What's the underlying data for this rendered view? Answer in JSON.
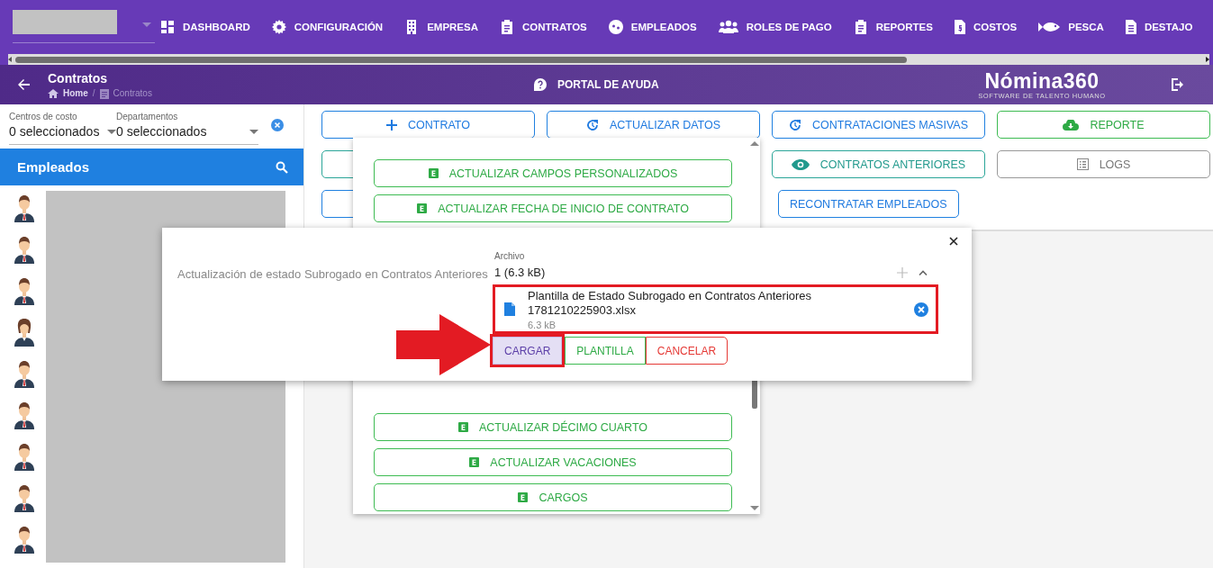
{
  "top_nav": {
    "items": [
      {
        "label": "DASHBOARD"
      },
      {
        "label": "CONFIGURACIÓN"
      },
      {
        "label": "EMPRESA"
      },
      {
        "label": "CONTRATOS"
      },
      {
        "label": "EMPLEADOS"
      },
      {
        "label": "ROLES DE PAGO"
      },
      {
        "label": "REPORTES"
      },
      {
        "label": "COSTOS"
      },
      {
        "label": "PESCA"
      },
      {
        "label": "DESTAJO"
      }
    ]
  },
  "page_header": {
    "title": "Contratos",
    "breadcrumb": [
      "Home",
      "Contratos"
    ],
    "breadcrumb_separator": "/",
    "help_link": "PORTAL DE AYUDA",
    "logo": {
      "name": "Nómina360",
      "tagline": "SOFTWARE DE TALENTO HUMANO"
    }
  },
  "filters": [
    {
      "label": "Centros de costo",
      "value": "0 seleccionados"
    },
    {
      "label": "Departamentos",
      "value": "0 seleccionados"
    }
  ],
  "employees": {
    "title": "Empleados",
    "items": [
      {
        "kind": "man"
      },
      {
        "kind": "man"
      },
      {
        "kind": "man"
      },
      {
        "kind": "woman"
      },
      {
        "kind": "man"
      },
      {
        "kind": "man"
      },
      {
        "kind": "man"
      },
      {
        "kind": "man"
      },
      {
        "kind": "man"
      }
    ]
  },
  "toolbar": {
    "rows": [
      [
        {
          "label": "CONTRATO",
          "kind": "primary"
        },
        {
          "label": "ACTUALIZAR DATOS",
          "kind": "primary"
        },
        {
          "label": "CONTRATACIONES MASIVAS",
          "kind": "primary"
        },
        {
          "label": "REPORTE",
          "kind": "success"
        }
      ],
      [
        {
          "kind": "info"
        },
        "",
        {
          "label": "CONTRATOS ANTERIORES",
          "kind": "info"
        },
        {
          "label": "LOGS",
          "kind": "neutral"
        }
      ],
      [
        {
          "kind": "primary"
        },
        "",
        {
          "label": "RECONTRATAR EMPLEADOS",
          "kind": "primary"
        }
      ]
    ]
  },
  "menu": {
    "items_above": [
      {
        "label": "ACTUALIZAR CAMPOS PERSONALIZADOS"
      },
      {
        "label": "ACTUALIZAR FECHA DE INICIO DE CONTRATO"
      }
    ],
    "items_below": [
      {
        "label": "ACTUALIZAR DÉCIMO CUARTO"
      },
      {
        "label": "ACTUALIZAR VACACIONES"
      },
      {
        "label": "CARGOS"
      }
    ]
  },
  "dialog": {
    "field_label": "Actualización de estado Subrogado en Contratos Anteriores",
    "upload": {
      "label": "Archivo",
      "summary": "1 (6.3 kB)",
      "files": [
        {
          "name": "Plantilla de Estado Subrogado en Contratos Anteriores 1781210225903.xlsx",
          "size": "6.3 kB",
          "highlighted": true
        }
      ]
    },
    "buttons": [
      {
        "label": "CARGAR",
        "kind": "primary",
        "highlighted": true
      },
      {
        "label": "PLANTILLA",
        "kind": "success",
        "highlighted": false
      },
      {
        "label": "CANCELAR",
        "kind": "danger",
        "highlighted": false
      }
    ]
  }
}
